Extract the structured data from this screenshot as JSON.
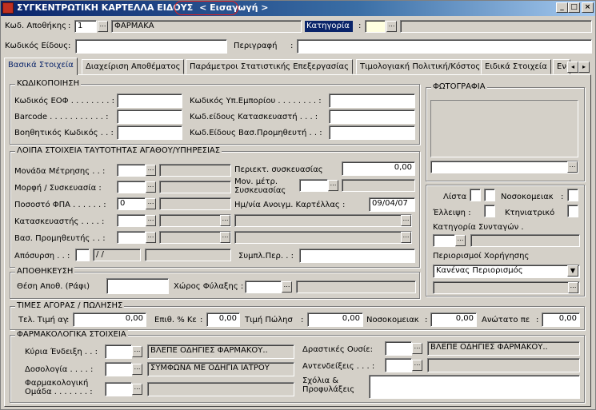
{
  "window": {
    "title": "ΣΥΓΚΕΝΤΡΩΤΙΚΗ ΚΑΡΤΕΛΛΑ ΕΙΔΟΥΣ",
    "mode": "< Εισαγωγή >",
    "min": "_",
    "max": "□",
    "close": "×"
  },
  "header": {
    "warehouse_label": "Κωδ. Αποθήκης",
    "warehouse_code": "1",
    "warehouse_name": "ΦΑΡΜΑΚΑ",
    "category_label": "Κατηγορία",
    "item_code_label": "Κωδικός Είδους",
    "description_label": "Περιγραφή"
  },
  "tabs": [
    {
      "label": "Βασικά Στοιχεία"
    },
    {
      "label": "Διαχείριση Αποθέματος"
    },
    {
      "label": "Παράμετροι Στατιστικής Επεξεργασίας"
    },
    {
      "label": "Τιμολογιακή Πολιτική/Κόστος"
    },
    {
      "label": "Ειδικά Στοιχεία"
    },
    {
      "label": "Εν"
    }
  ],
  "coding": {
    "title": "ΚΩΔΙΚΟΠΟΙΗΣΗ",
    "eof": "Κωδικός ΕΟΦ . . . . . . . . :",
    "barcode": "Barcode . . . . . . . . . . . :",
    "aux": "Βοηθητικός Κωδικός . . :",
    "ministry": "Κωδικός Υπ.Εμπορίου . . . . . . . . :",
    "manufacturer_code": "Κωδ.είδους Κατασκευαστή . . . :",
    "supplier_code": "Κωδ.Είδους Βασ.Προμηθευτή . . :"
  },
  "identity": {
    "title": "ΛΟΙΠΑ ΣΤΟΙΧΕΙΑ ΤΑΥΤΟΤΗΤΑΣ ΑΓΑΘΟΥ/ΥΠΗΡΕΣΙΑΣ",
    "unit": "Μονάδα Μέτρησης . . :",
    "form": "Μορφή / Συσκευασία :",
    "vat": "Ποσοστό ΦΠΑ . . . . . . :",
    "vat_value": "0",
    "manufacturer": "Κατασκευαστής . . . . :",
    "supplier": "Βασ. Προμηθευτής . . :",
    "withdrawal": "Απόσυρση . . :",
    "withdrawal_date": "/ /",
    "package_content": "Περιεκτ. συσκευασίας",
    "package_value": "0,00",
    "package_unit": "Μον. μέτρ. Συσκευασίας",
    "open_date_label": "Ημ/νία Ανοιγμ. Καρτέλλας :",
    "open_date": "09/04/07",
    "filled": "Συμπλ.Περ. . :"
  },
  "storage": {
    "title": "ΑΠΟΘΗΚΕΥΣΗ",
    "position": "Θέση Αποθ. (Ράφι)",
    "space": "Χώρος Φύλαξης :"
  },
  "prices": {
    "title": "ΤΙΜΕΣ ΑΓΟΡΑΣ / ΠΩΛΗΣΗΣ",
    "last_buy": "Τελ. Τιμή αγ",
    "last_buy_value": "0,00",
    "markup": "Επιθ. % Κε",
    "markup_value": "0,00",
    "sale": "Τιμή Πώλησ",
    "sale_value": "0,00",
    "hospital": "Νοσοκομειακ",
    "hospital_value": "0,00",
    "max": "Ανώτατο πε",
    "max_value": "0,00"
  },
  "pharma": {
    "title": "ΦΑΡΜΑΚΟΛΟΓΙΚΑ ΣΤΟΙΧΕΙΑ",
    "indication": "Κύρια Ένδειξη . . :",
    "indication_value": "ΒΛΕΠΕ ΟΔΗΓΙΕΣ ΦΑΡΜΑΚΟΥ..",
    "dosage": "Δοσολογία . . . . :",
    "dosage_value": "ΣΥΜΦΩΝΑ ΜΕ ΟΔΗΓΙΑ ΙΑΤΡΟΥ",
    "group_line1": "Φαρμακολογική",
    "group_line2": "Ομάδα . . . . . . . :",
    "substances": "Δραστικές Ουσίε:",
    "substances_value": "ΒΛΕΠΕ ΟΔΗΓΙΕΣ ΦΑΡΜΑΚΟΥ..",
    "contra": "Αντενδείξεις . . . :",
    "comments_line1": "Σχόλια &",
    "comments_line2": "Προφυλάξεις"
  },
  "photo": {
    "title": "ΦΩΤΟΓΡΑΦΙΑ"
  },
  "flags": {
    "list": "Λίστα :",
    "hospital": "Νοσοκομειακ",
    "shortage": "Έλλειψη :",
    "vet": "Κτηνιατρικό",
    "rx_category": "Κατηγορία Συνταγών .",
    "restrictions": "Περιορισμοί Χορήγησης",
    "restriction_value": "Κανένας Περιορισμός"
  },
  "icons": {
    "dots": "ellipsis-icon",
    "combo": "chevron-down-icon"
  }
}
